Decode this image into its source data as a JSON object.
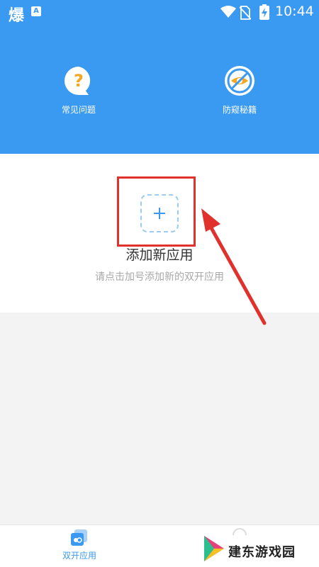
{
  "status_bar": {
    "app_glyph": "爆",
    "notif_glyph": "A",
    "time": "10:44"
  },
  "header": {
    "features": [
      {
        "label": "常见问题",
        "icon": "question-bubble-icon"
      },
      {
        "label": "防窥秘籍",
        "icon": "no-eye-icon"
      }
    ]
  },
  "add_app": {
    "title": "添加新应用",
    "subtitle": "请点击加号添加新的双开应用"
  },
  "bottom_nav": {
    "items": [
      {
        "label": "双开应用",
        "icon": "dual-apps-icon",
        "active": true
      }
    ]
  },
  "watermark": {
    "text": "建东游戏园"
  },
  "colors": {
    "brand_blue": "#3a99f1",
    "annotation_red": "#e0312c",
    "icon_orange": "#f5a623"
  }
}
